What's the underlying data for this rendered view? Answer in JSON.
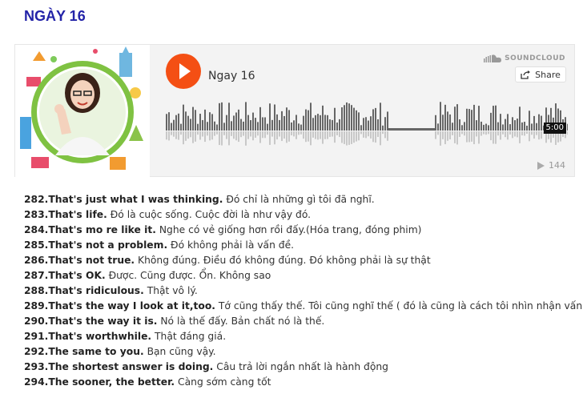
{
  "page": {
    "title": "NGÀY 16"
  },
  "player": {
    "track_title": "Ngay 16",
    "brand": "SOUNDCLOUD",
    "share_label": "Share",
    "duration": "5:00",
    "plays": "144",
    "accent_color": "#f44f14",
    "icons": [
      "play-icon",
      "soundcloud-icon",
      "share-icon",
      "plays-icon"
    ]
  },
  "phrases": [
    {
      "en": "282.That's just what I was thinking.",
      "vi": "Đó chỉ là những gì tôi đã nghĩ."
    },
    {
      "en": "283.That's life.",
      "vi": "Đó là cuộc sống. Cuộc đời là như vậy đó."
    },
    {
      "en": "284.That's mo re like it.",
      "vi": "Nghe có vẻ giống hơn rồi đấy.(Hóa trang, đóng phim)"
    },
    {
      "en": "285.That's not a problem.",
      "vi": "Đó không phải là vấn đề."
    },
    {
      "en": "286.That's not true.",
      "vi": "Không đúng. Điều đó không đúng. Đó không phải là sự thật"
    },
    {
      "en": "287.That's OK.",
      "vi": "Được. Cũng được. Ổn. Không sao"
    },
    {
      "en": "288.That's ridiculous.",
      "vi": "Thật vô lý."
    },
    {
      "en": "289.That's the way I look at it,too.",
      "vi": "Tớ cũng thấy thế. Tôi cũng nghĩ thế ( đó là cũng là cách tôi nhìn nhận vấn đề)"
    },
    {
      "en": "290.That's the way it is.",
      "vi": "Nó là thế đấy. Bản chất nó là thế."
    },
    {
      "en": "291.That's worthwhile.",
      "vi": "Thật đáng giá."
    },
    {
      "en": "292.The same to you.",
      "vi": "Bạn cũng vậy."
    },
    {
      "en": "293.The shortest answer is doing.",
      "vi": "Câu trả lời ngắn nhất là hành động"
    },
    {
      "en": "294.The sooner, the better.",
      "vi": "Càng sớm càng tốt"
    }
  ]
}
